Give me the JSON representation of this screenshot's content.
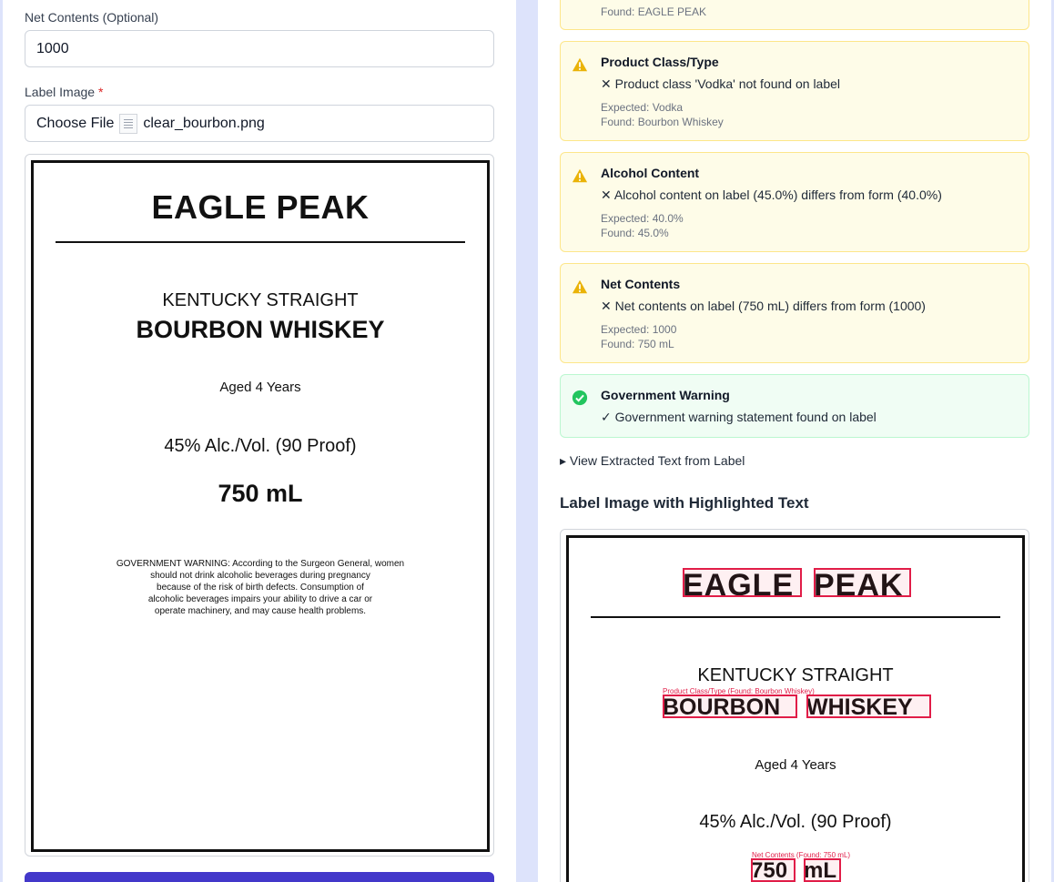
{
  "form": {
    "net_contents_label": "Net Contents (Optional)",
    "net_contents_value": "1000",
    "label_image_label": "Label Image",
    "required_mark": "*",
    "choose_file_label": "Choose File",
    "file_name": "clear_bourbon.png"
  },
  "label": {
    "brand": "EAGLE PEAK",
    "class_line1": "KENTUCKY STRAIGHT",
    "class_line2": "BOURBON WHISKEY",
    "age": "Aged 4 Years",
    "abv": "45% Alc./Vol. (90 Proof)",
    "volume": "750 mL",
    "warning": [
      "GOVERNMENT WARNING: According to the Surgeon General, women",
      "should not drink alcoholic beverages during pregnancy",
      "because of the risk of birth defects. Consumption of",
      "alcoholic beverages impairs your ability to drive a car or",
      "operate machinery, and may cause health problems."
    ]
  },
  "results": {
    "partial_top": {
      "found": "Found: EAGLE PEAK"
    },
    "checks": [
      {
        "status": "warning",
        "title": "Product Class/Type",
        "message": "✕ Product class 'Vodka' not found on label",
        "expected": "Expected: Vodka",
        "found": "Found: Bourbon Whiskey"
      },
      {
        "status": "warning",
        "title": "Alcohol Content",
        "message": "✕ Alcohol content on label (45.0%) differs from form (40.0%)",
        "expected": "Expected: 40.0%",
        "found": "Found: 45.0%"
      },
      {
        "status": "warning",
        "title": "Net Contents",
        "message": "✕ Net contents on label (750 mL) differs from form (1000)",
        "expected": "Expected: 1000",
        "found": "Found: 750 mL"
      },
      {
        "status": "pass",
        "title": "Government Warning",
        "message": "✓ Government warning statement found on label"
      }
    ],
    "details_toggle": "▸ View Extracted Text from Label",
    "highlight_heading": "Label Image with Highlighted Text"
  },
  "highlights": {
    "brand_word1": "EAGLE",
    "brand_word2": "PEAK",
    "class_caption": "Product Class/Type (Found: Bourbon Whiskey)",
    "class_word1": "BOURBON",
    "class_word2": "WHISKEY",
    "net_caption": "Net Contents (Found: 750 mL)",
    "net_word1": "750",
    "net_word2": "mL"
  },
  "colors": {
    "page_bg": "#dde3fb",
    "warning_bg": "#fefce8",
    "warning_icon": "#eab308",
    "pass_bg": "#f0fdf4",
    "pass_icon": "#22c55e",
    "highlight": "#e11d48",
    "primary_button": "#4338ca"
  }
}
